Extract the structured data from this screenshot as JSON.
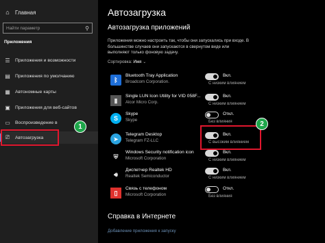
{
  "sidebar": {
    "home_label": "Главная",
    "search_placeholder": "Найти параметр",
    "section_title": "Приложения",
    "items": [
      {
        "label": "Приложения и возможности",
        "icon": "apps-list-icon"
      },
      {
        "label": "Приложения по умолчанию",
        "icon": "default-apps-icon"
      },
      {
        "label": "Автономные карты",
        "icon": "map-icon"
      },
      {
        "label": "Приложения для веб-сайтов",
        "icon": "web-apps-icon"
      },
      {
        "label": "Воспроизведение в",
        "icon": "video-icon"
      },
      {
        "label": "Автозагрузка",
        "icon": "startup-icon",
        "active": true
      }
    ]
  },
  "main": {
    "title": "Автозагрузка",
    "subtitle": "Автозагрузка приложений",
    "description": "Приложения можно настроить так, чтобы они запускались при входе. В большинстве случаев они запускаются в свернутом виде или выполняют только фоновую задачу.",
    "sort_label": "Сортировка:",
    "sort_value": "Имя",
    "apps": [
      {
        "name": "Bluetooth Tray Application",
        "publisher": "Broadcom Corporation.",
        "state": "Вкл.",
        "on": true,
        "impact": "С низким влиянием",
        "icon": "bluetooth-icon",
        "icon_color": "#1e6fd9"
      },
      {
        "name": "Single LUN Icon Utility for VID 058F...",
        "publisher": "Alcor Micro Corp.",
        "state": "Вкл.",
        "on": true,
        "impact": "С низким влиянием",
        "icon": "usb-drive-icon",
        "icon_color": "#555555"
      },
      {
        "name": "Skype",
        "publisher": "Skype",
        "state": "Откл.",
        "on": false,
        "impact": "Без влияния",
        "icon": "skype-icon",
        "icon_color": "#00aff0"
      },
      {
        "name": "Telegram Desktop",
        "publisher": "Telegram FZ-LLC",
        "state": "Вкл.",
        "on": true,
        "impact": "С высоким влиянием",
        "icon": "telegram-icon",
        "icon_color": "#2aa3df"
      },
      {
        "name": "Windows Security notification icon",
        "publisher": "Microsoft Corporation",
        "state": "Вкл.",
        "on": true,
        "impact": "С низким влиянием",
        "icon": "shield-icon",
        "icon_color": "#e8e8e8"
      },
      {
        "name": "Диспетчер Realtek HD",
        "publisher": "Realtek Semiconductor",
        "state": "Вкл.",
        "on": true,
        "impact": "С низким влиянием",
        "icon": "speaker-icon",
        "icon_color": "#e8e8e8"
      },
      {
        "name": "Связь с телефоном",
        "publisher": "Microsoft Corporation",
        "state": "Откл.",
        "on": false,
        "impact": "Без влияния",
        "icon": "phone-link-icon",
        "icon_color": "#e0322e"
      }
    ],
    "help_title": "Справка в Интернете",
    "help_link": "Добавление приложения к запуску"
  },
  "annotations": {
    "badge_1": "1",
    "badge_2": "2",
    "callout_color": "#e2172e",
    "badge_color": "#1ea64a"
  }
}
